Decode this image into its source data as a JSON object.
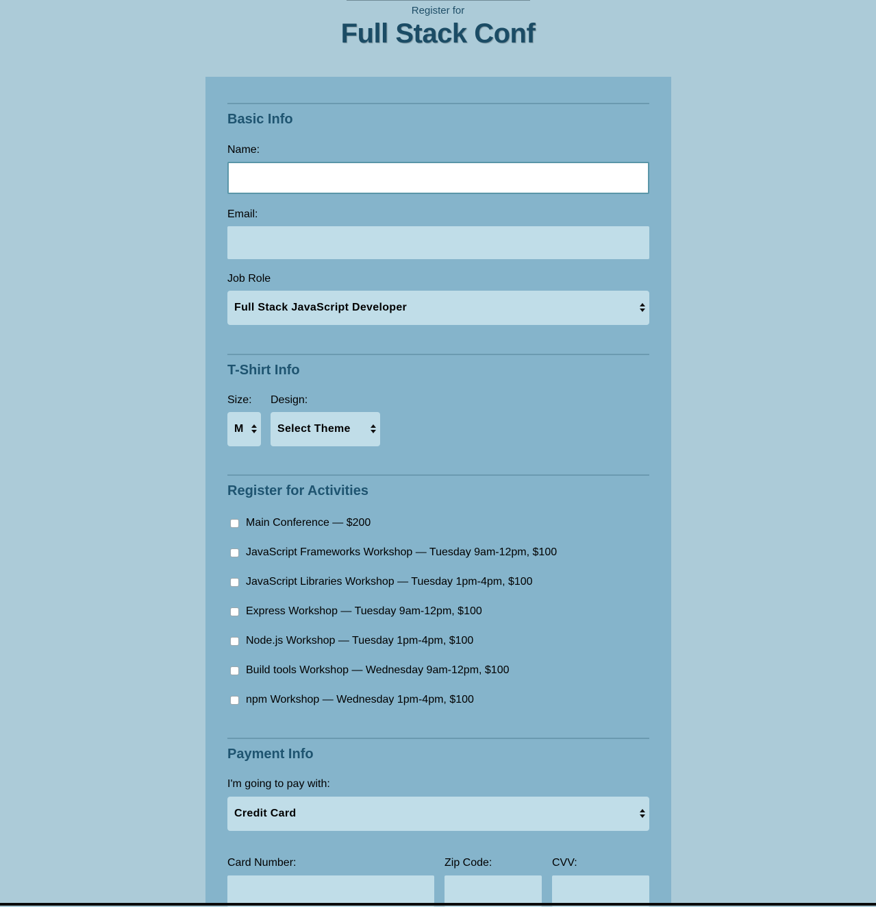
{
  "header": {
    "pre_title": "Register for",
    "title": "Full Stack Conf"
  },
  "basic_info": {
    "legend": "Basic Info",
    "name_label": "Name:",
    "name_value": "",
    "email_label": "Email:",
    "email_value": "",
    "job_role_label": "Job Role",
    "job_role_value": "Full Stack JavaScript Developer"
  },
  "tshirt_info": {
    "legend": "T-Shirt Info",
    "size_label": "Size:",
    "size_value": "M",
    "design_label": "Design:",
    "design_value": "Select Theme"
  },
  "activities": {
    "legend": "Register for Activities",
    "items": [
      {
        "label": "Main Conference — $200",
        "checked": false
      },
      {
        "label": "JavaScript Frameworks Workshop — Tuesday 9am-12pm, $100",
        "checked": false
      },
      {
        "label": "JavaScript Libraries Workshop — Tuesday 1pm-4pm, $100",
        "checked": false
      },
      {
        "label": "Express Workshop — Tuesday 9am-12pm, $100",
        "checked": false
      },
      {
        "label": "Node.js Workshop — Tuesday 1pm-4pm, $100",
        "checked": false
      },
      {
        "label": "Build tools Workshop — Wednesday 9am-12pm, $100",
        "checked": false
      },
      {
        "label": "npm Workshop — Wednesday 1pm-4pm, $100",
        "checked": false
      }
    ]
  },
  "payment_info": {
    "legend": "Payment Info",
    "pay_with_label": "I'm going to pay with:",
    "pay_with_value": "Credit Card",
    "card_number_label": "Card Number:",
    "zip_label": "Zip Code:",
    "cvv_label": "CVV:"
  },
  "colors": {
    "page_background": "#accbd8",
    "panel_background": "#85b4cb",
    "input_background": "#c0dde8",
    "heading_color": "#1b4c65"
  },
  "icons": {
    "select_arrow": "updown-arrows-icon"
  }
}
